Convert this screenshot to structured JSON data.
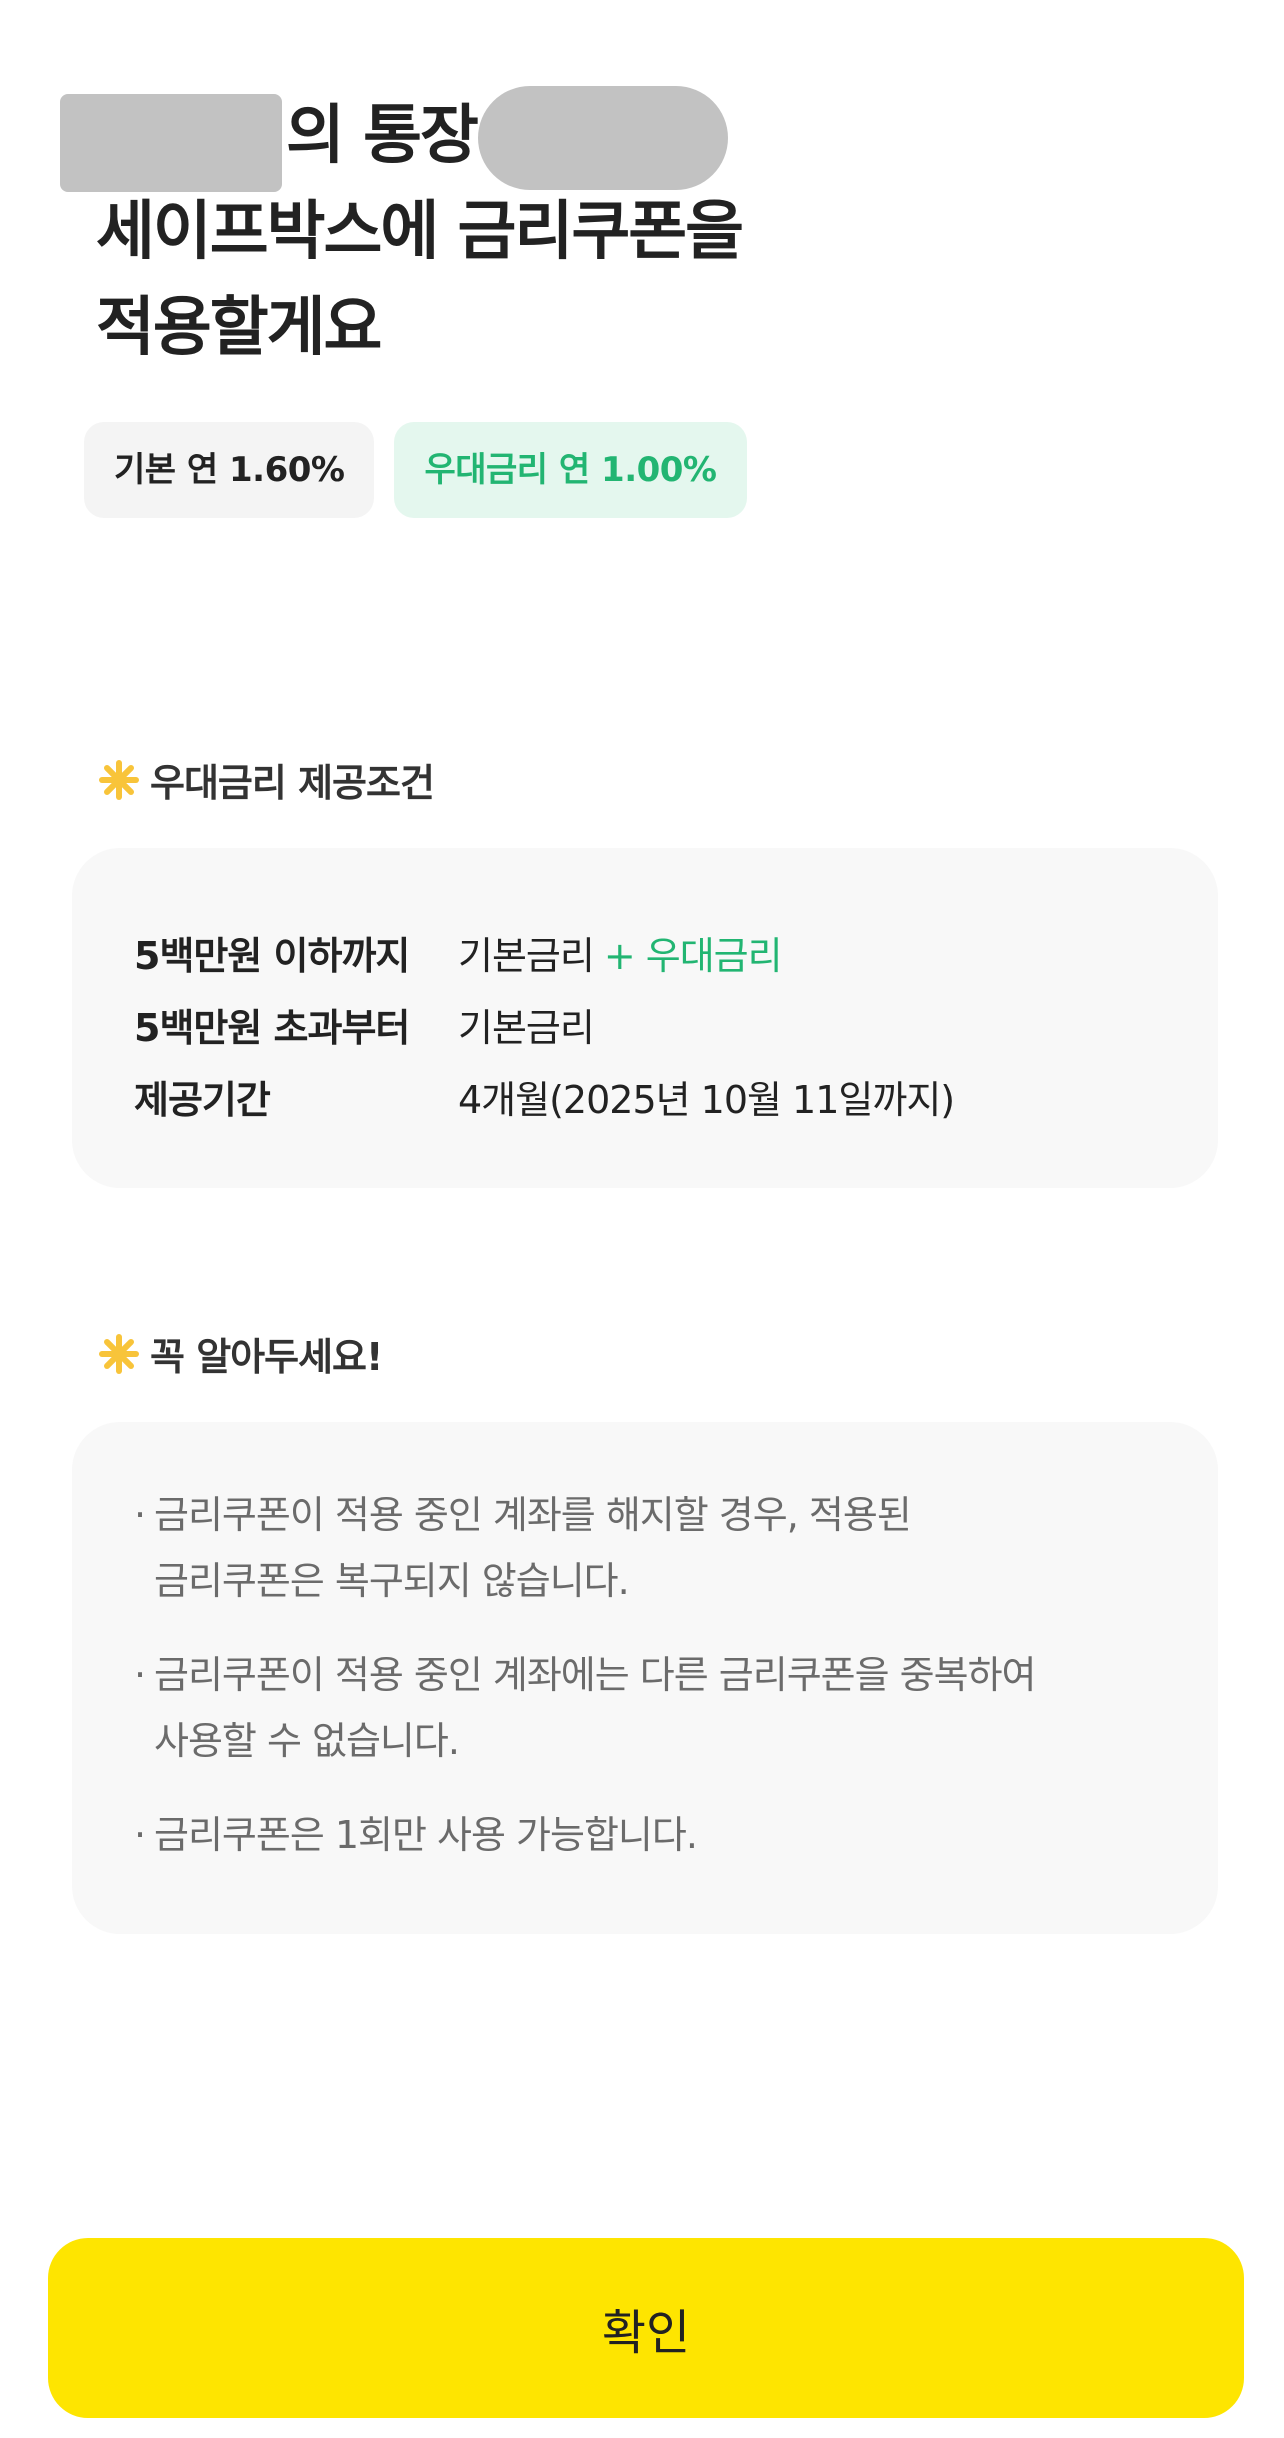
{
  "header": {
    "title_line1": "의 통장",
    "title_line2": "세이프박스에 금리쿠폰을",
    "title_line3": "적용할게요"
  },
  "rates": {
    "base_label": "기본 연 1.60%",
    "preferential_label": "우대금리 연 1.00%"
  },
  "conditions": {
    "heading": "우대금리 제공조건",
    "rows": [
      {
        "label": "5백만원 이하까지",
        "value": "기본금리",
        "extra": "+ 우대금리"
      },
      {
        "label": "5백만원 초과부터",
        "value": "기본금리",
        "extra": ""
      },
      {
        "label": "제공기간",
        "value": "4개월(2025년 10월 11일까지)",
        "extra": ""
      }
    ]
  },
  "notice": {
    "heading": "꼭 알아두세요!",
    "bullet": "·",
    "items": [
      "금리쿠폰이 적용 중인 계좌를 해지할 경우, 적용된\n금리쿠폰은 복구되지 않습니다.",
      "금리쿠폰이 적용 중인 계좌에는 다른 금리쿠폰을 중복하여\n사용할 수 없습니다.",
      "금리쿠폰은 1회만 사용 가능합니다."
    ]
  },
  "footer": {
    "confirm_label": "확인"
  },
  "icons": {
    "section_icon": "asterisk-star-icon"
  },
  "colors": {
    "accent_yellow": "#fee500",
    "accent_green": "#22b572",
    "star_yellow": "#f8c43a",
    "redaction_gray": "#c2c2c2"
  }
}
